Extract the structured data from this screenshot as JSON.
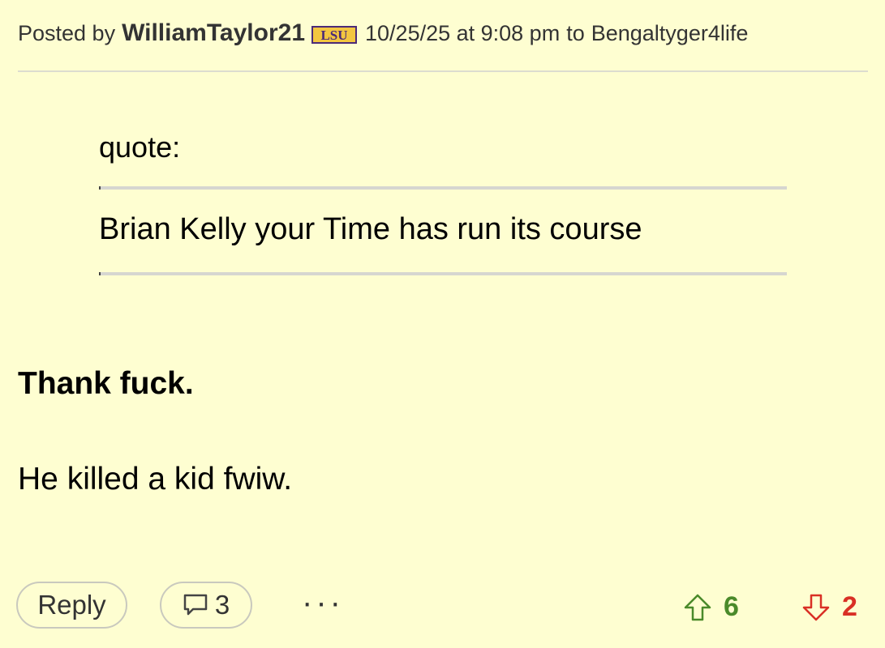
{
  "post": {
    "posted_by_label": "Posted by",
    "author": "WilliamTaylor21",
    "badge_text": "LSU",
    "timestamp": "10/25/25 at 9:08 pm",
    "to_label": "to",
    "recipient": "Bengaltyger4life"
  },
  "quote": {
    "label": "quote:",
    "text": "Brian Kelly your Time has run its course"
  },
  "body": {
    "bold_line": "Thank fuck.",
    "plain_line": "He killed a kid fwiw."
  },
  "actions": {
    "reply_label": "Reply",
    "comment_count": "3",
    "more_label": "···",
    "upvotes": "6",
    "downvotes": "2"
  },
  "colors": {
    "background": "#fefed1",
    "upvote": "#4a8a2a",
    "downvote": "#d93025",
    "badge_purple": "#4b2a78",
    "badge_gold": "#f3c640"
  }
}
